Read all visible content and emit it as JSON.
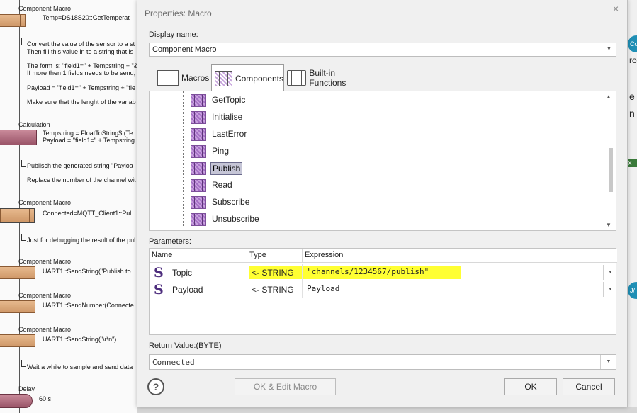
{
  "flowchart": {
    "items": [
      {
        "label": "Component Macro",
        "text": [
          "Temp=DS18S20::GetTemperat"
        ]
      },
      {
        "label": "",
        "text": [
          "Convert the value of the sensor to a st",
          "Then fill this value in to a string that is"
        ]
      },
      {
        "label": "",
        "text": [
          "The form is: \"field1=\" + Tempstring + \"&",
          "If more then 1 fields needs to be send,"
        ]
      },
      {
        "label": "",
        "text": [
          "Payload = \"field1=\" + Tempstring + \"fie"
        ]
      },
      {
        "label": "",
        "text": [
          "Make sure that the lenght of the variab"
        ]
      },
      {
        "label": "Calculation",
        "text": [
          "Tempstring = FloatToString$ (Te",
          "Payload = \"field1=\" + Tempstring"
        ]
      },
      {
        "label": "",
        "text": [
          "Publisch the generated string \"Payloa"
        ]
      },
      {
        "label": "",
        "text": [
          "Replace the number of the channel wit"
        ]
      },
      {
        "label": "Component Macro",
        "text": [
          "Connected=MQTT_Client1::Pul"
        ]
      },
      {
        "label": "",
        "text": [
          "Just for debugging the result of the pul"
        ]
      },
      {
        "label": "Component Macro",
        "text": [
          "UART1::SendString(\"Publish to"
        ]
      },
      {
        "label": "Component Macro",
        "text": [
          "UART1::SendNumber(Connecte"
        ]
      },
      {
        "label": "Component Macro",
        "text": [
          "UART1::SendString(\"\\r\\n\")"
        ]
      },
      {
        "label": "",
        "text": [
          "Wait a while to sample and send data"
        ]
      },
      {
        "label": "Delay",
        "text": [
          "60 s"
        ]
      }
    ]
  },
  "right_edge": {
    "circle1": "Co",
    "text1": "ro",
    "text2": "e",
    "text3": "n",
    "text4": "x",
    "circle2": "J/"
  },
  "dialog": {
    "title": "Properties: Macro",
    "close": "×",
    "display_name_label": "Display name:",
    "display_name_value": "Component Macro",
    "tabs": [
      {
        "label": "Macros",
        "icon": "macro-icon"
      },
      {
        "label": "Components",
        "icon": "component-icon"
      },
      {
        "label": "Built-in Functions",
        "icon": "builtin-icon"
      }
    ],
    "tree_items": [
      "GetTopic",
      "Initialise",
      "LastError",
      "Ping",
      "Publish",
      "Read",
      "Subscribe",
      "Unsubscribe"
    ],
    "selected_item": "Publish",
    "parameters_label": "Parameters:",
    "param_headers": [
      "Name",
      "Type",
      "Expression"
    ],
    "params": [
      {
        "name": "Topic",
        "type": "<- STRING",
        "expression": "\"channels/1234567/publish\""
      },
      {
        "name": "Payload",
        "type": "<- STRING",
        "expression": "Payload"
      }
    ],
    "return_label": "Return Value:(BYTE)",
    "return_value": "Connected",
    "buttons": {
      "help": "?",
      "ok_edit": "OK & Edit Macro",
      "ok": "OK",
      "cancel": "Cancel"
    },
    "highlight_color": "#ffff33"
  }
}
